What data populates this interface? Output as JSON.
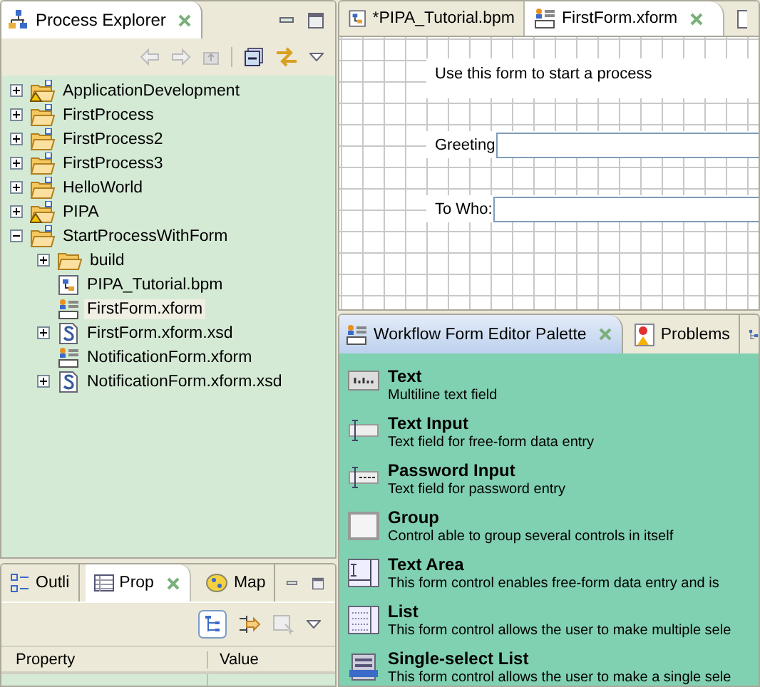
{
  "explorer": {
    "title": "Process Explorer",
    "tree": [
      {
        "label": "ApplicationDevelopment",
        "kind": "project-warning",
        "expanded": false,
        "selected": false
      },
      {
        "label": "FirstProcess",
        "kind": "project",
        "expanded": false,
        "selected": false
      },
      {
        "label": "FirstProcess2",
        "kind": "project",
        "expanded": false,
        "selected": false
      },
      {
        "label": "FirstProcess3",
        "kind": "project",
        "expanded": false,
        "selected": false
      },
      {
        "label": "HelloWorld",
        "kind": "project",
        "expanded": false,
        "selected": false
      },
      {
        "label": "PIPA",
        "kind": "project-warning",
        "expanded": false,
        "selected": false
      },
      {
        "label": "StartProcessWithForm",
        "kind": "project",
        "expanded": true,
        "selected": false,
        "children": [
          {
            "label": "build",
            "kind": "folder",
            "expanded": false,
            "selected": false
          },
          {
            "label": "PIPA_Tutorial.bpm",
            "kind": "bpm",
            "selected": false
          },
          {
            "label": "FirstForm.xform",
            "kind": "xform",
            "selected": true
          },
          {
            "label": "FirstForm.xform.xsd",
            "kind": "xsd",
            "expanded": false,
            "selected": false
          },
          {
            "label": "NotificationForm.xform",
            "kind": "xform",
            "selected": false
          },
          {
            "label": "NotificationForm.xform.xsd",
            "kind": "xsd",
            "expanded": false,
            "selected": false
          }
        ]
      }
    ]
  },
  "bottom_tabs": [
    {
      "label": "Outli",
      "kind": "outline",
      "selected": false
    },
    {
      "label": "Prop",
      "kind": "properties",
      "selected": true
    },
    {
      "label": "Map",
      "kind": "map",
      "selected": false
    }
  ],
  "properties": {
    "columns": [
      "Property",
      "Value"
    ]
  },
  "editor_tabs": [
    {
      "label": "*PIPA_Tutorial.bpm",
      "kind": "bpm",
      "selected": false
    },
    {
      "label": "FirstForm.xform",
      "kind": "xform",
      "selected": true
    }
  ],
  "form": {
    "heading": "Use this form to start a process",
    "fields": [
      {
        "label": "Greeting"
      },
      {
        "label": "To Who:"
      }
    ]
  },
  "palette_tabs": [
    {
      "label": "Workflow Form Editor Palette",
      "kind": "xform",
      "selected": true
    },
    {
      "label": "Problems",
      "kind": "problems",
      "selected": false
    }
  ],
  "palette": [
    {
      "title": "Text",
      "description": "Multiline text field",
      "kind": "text"
    },
    {
      "title": "Text Input",
      "description": "Text field for free-form data entry",
      "kind": "input"
    },
    {
      "title": "Password Input",
      "description": "Text field for password entry",
      "kind": "password"
    },
    {
      "title": "Group",
      "description": "Control able to group several controls in itself",
      "kind": "group"
    },
    {
      "title": "Text Area",
      "description": "This form control enables free-form data entry and is",
      "kind": "textarea"
    },
    {
      "title": "List",
      "description": "This form control allows the user to make multiple sele",
      "kind": "list"
    },
    {
      "title": "Single-select List",
      "description": "This form control allows the user to make a single sele",
      "kind": "single"
    }
  ]
}
